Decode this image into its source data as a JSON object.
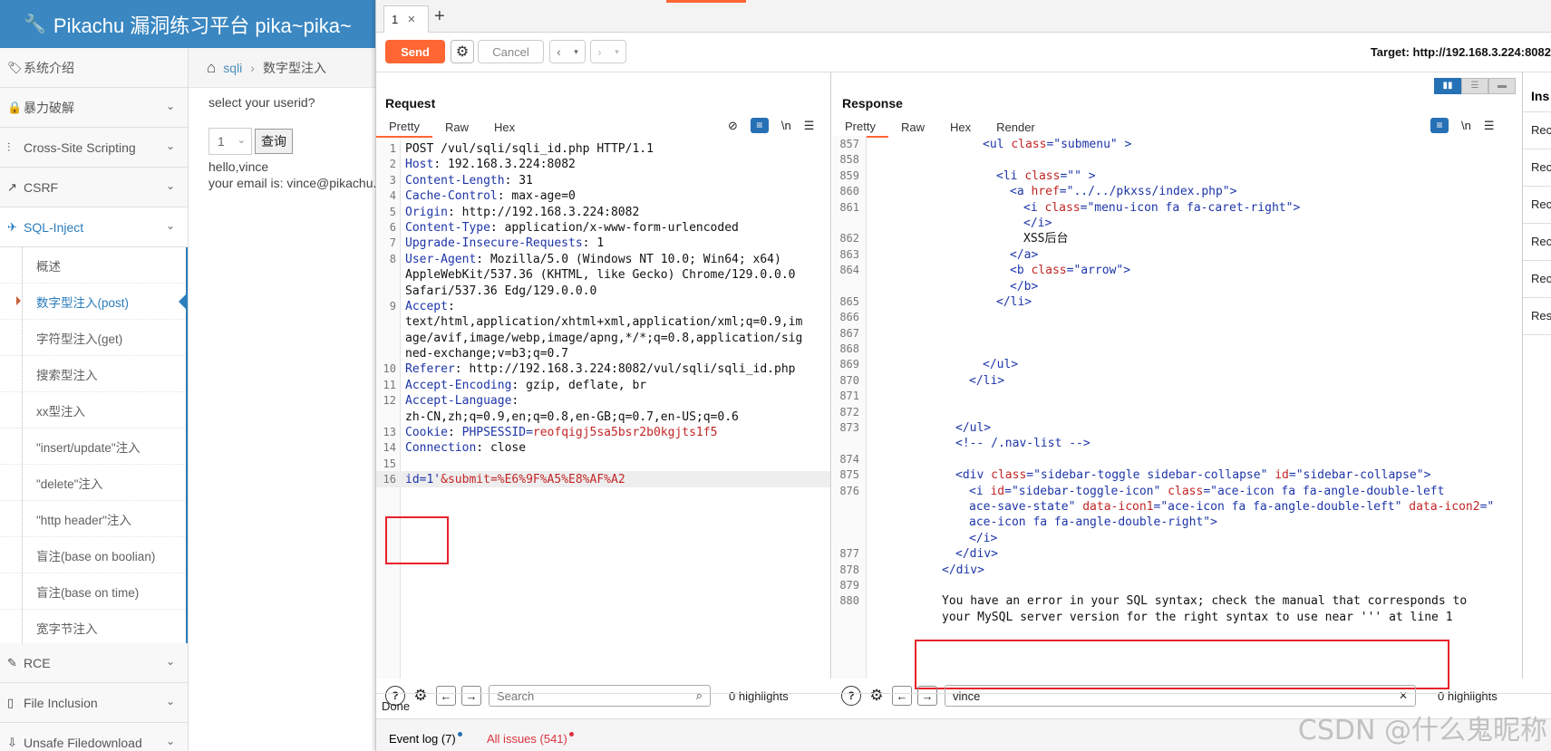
{
  "pikachu": {
    "title": "Pikachu 漏洞练习平台 pika~pika~",
    "nav": [
      {
        "label": "系统介绍",
        "icon": "tag-icon",
        "glyph": "🏷",
        "chevron": false,
        "active": false
      },
      {
        "label": "暴力破解",
        "icon": "lock-icon",
        "glyph": "🔒",
        "chevron": true,
        "active": false
      },
      {
        "label": "Cross-Site Scripting",
        "icon": "sliders-icon",
        "glyph": "⫶",
        "chevron": true,
        "active": false
      },
      {
        "label": "CSRF",
        "icon": "share-icon",
        "glyph": "↗",
        "chevron": true,
        "active": false
      },
      {
        "label": "SQL-Inject",
        "icon": "plane-icon",
        "glyph": "✈",
        "chevron": true,
        "active": true
      }
    ],
    "sql_sub": [
      "概述",
      "数字型注入(post)",
      "字符型注入(get)",
      "搜索型注入",
      "xx型注入",
      "\"insert/update\"注入",
      "\"delete\"注入",
      "\"http header\"注入",
      "盲注(base on boolian)",
      "盲注(base on time)",
      "宽字节注入"
    ],
    "nav_after": [
      {
        "label": "RCE",
        "icon": "pencil-icon",
        "glyph": "✎"
      },
      {
        "label": "File Inclusion",
        "icon": "file-icon",
        "glyph": "▯"
      },
      {
        "label": "Unsafe Filedownload",
        "icon": "download-icon",
        "glyph": "⇩"
      }
    ],
    "breadcrumb": {
      "link": "sqli",
      "current": "数字型注入"
    },
    "content": {
      "prompt": "select your userid?",
      "select_value": "1",
      "query_button": "查询",
      "line1": "hello,vince",
      "line2": "your email is: vince@pikachu.com"
    }
  },
  "burp": {
    "tab_label": "1",
    "send": "Send",
    "cancel": "Cancel",
    "target": "Target: http://192.168.3.224:8082",
    "request": {
      "title": "Request",
      "tabs": [
        "Pretty",
        "Raw",
        "Hex"
      ],
      "newline_label": "\\n",
      "search_placeholder": "Search",
      "highlights": "0 highlights"
    },
    "response": {
      "title": "Response",
      "tabs": [
        "Pretty",
        "Raw",
        "Hex",
        "Render"
      ],
      "newline_label": "\\n",
      "search_value": "vince",
      "highlights": "0 highlights"
    },
    "inspector": {
      "title": "Ins",
      "items": [
        "Rec",
        "Rec",
        "Rec",
        "Rec",
        "Rec",
        "Res"
      ]
    },
    "status": "Done",
    "event_log": "Event log (7)",
    "all_issues": "All issues (541)",
    "colors": {
      "accent": "#ff6633",
      "blue": "#2670b5",
      "red_box": "#e8212b"
    }
  },
  "request_lines": [
    {
      "n": "1",
      "t": "POST /vul/sqli/sqli_id.php HTTP/1.1"
    },
    {
      "n": "2",
      "k": "Host",
      "v": "192.168.3.224:8082"
    },
    {
      "n": "3",
      "k": "Content-Length",
      "v": "31"
    },
    {
      "n": "4",
      "k": "Cache-Control",
      "v": "max-age=0"
    },
    {
      "n": "5",
      "k": "Origin",
      "v": "http://192.168.3.224:8082"
    },
    {
      "n": "6",
      "k": "Content-Type",
      "v": "application/x-www-form-urlencoded"
    },
    {
      "n": "7",
      "k": "Upgrade-Insecure-Requests",
      "v": "1"
    },
    {
      "n": "8",
      "k": "User-Agent",
      "v": "Mozilla/5.0 (Windows NT 10.0; Win64; x64)"
    },
    {
      "n": "",
      "t": "AppleWebKit/537.36 (KHTML, like Gecko) Chrome/129.0.0.0"
    },
    {
      "n": "",
      "t": "Safari/537.36 Edg/129.0.0.0"
    },
    {
      "n": "9",
      "k": "Accept",
      "v": ""
    },
    {
      "n": "",
      "t": "text/html,application/xhtml+xml,application/xml;q=0.9,im"
    },
    {
      "n": "",
      "t": "age/avif,image/webp,image/apng,*/*;q=0.8,application/sig"
    },
    {
      "n": "",
      "t": "ned-exchange;v=b3;q=0.7"
    },
    {
      "n": "10",
      "k": "Referer",
      "v": "http://192.168.3.224:8082/vul/sqli/sqli_id.php"
    },
    {
      "n": "11",
      "k": "Accept-Encoding",
      "v": "gzip, deflate, br"
    },
    {
      "n": "12",
      "k": "Accept-Language",
      "v": ""
    },
    {
      "n": "",
      "t": "zh-CN,zh;q=0.9,en;q=0.8,en-GB;q=0.7,en-US;q=0.6"
    },
    {
      "n": "13",
      "k": "Cookie",
      "ck": "PHPSESSID",
      "cv": "reofqigj5sa5bsr2b0kgjts1f5"
    },
    {
      "n": "14",
      "k": "Connection",
      "v": "close"
    },
    {
      "n": "15",
      "t": ""
    },
    {
      "n": "16",
      "body": true,
      "p1": "id",
      "v1": "1'",
      "p2": "submit",
      "v2": "%E6%9F%A5%E8%AF%A2"
    }
  ],
  "response_lines": [
    {
      "n": "857",
      "i": 8,
      "h": [
        [
          "tag",
          "<ul "
        ],
        [
          "at",
          "class"
        ],
        [
          "tag",
          "="
        ],
        [
          "av",
          "\"submenu\""
        ],
        [
          "tag",
          " >"
        ]
      ]
    },
    {
      "n": "858",
      "i": 0,
      "h": []
    },
    {
      "n": "859",
      "i": 9,
      "h": [
        [
          "tag",
          "<li "
        ],
        [
          "at",
          "class"
        ],
        [
          "tag",
          "="
        ],
        [
          "av",
          "\"\""
        ],
        [
          "tag",
          " >"
        ]
      ]
    },
    {
      "n": "860",
      "i": 10,
      "h": [
        [
          "tag",
          "<a "
        ],
        [
          "at",
          "href"
        ],
        [
          "tag",
          "="
        ],
        [
          "av",
          "\"../../pkxss/index.php\""
        ],
        [
          "tag",
          ">"
        ]
      ]
    },
    {
      "n": "861",
      "i": 11,
      "h": [
        [
          "tag",
          "<i "
        ],
        [
          "at",
          "class"
        ],
        [
          "tag",
          "="
        ],
        [
          "av",
          "\"menu-icon fa fa-caret-right\""
        ],
        [
          "tag",
          ">"
        ]
      ]
    },
    {
      "n": "",
      "i": 11,
      "h": [
        [
          "tag",
          "</i>"
        ]
      ]
    },
    {
      "n": "862",
      "i": 11,
      "h": [
        [
          "txt",
          "XSS后台"
        ]
      ]
    },
    {
      "n": "863",
      "i": 10,
      "h": [
        [
          "tag",
          "</a>"
        ]
      ]
    },
    {
      "n": "864",
      "i": 10,
      "h": [
        [
          "tag",
          "<b "
        ],
        [
          "at",
          "class"
        ],
        [
          "tag",
          "="
        ],
        [
          "av",
          "\"arrow\""
        ],
        [
          "tag",
          ">"
        ]
      ]
    },
    {
      "n": "",
      "i": 10,
      "h": [
        [
          "tag",
          "</b>"
        ]
      ]
    },
    {
      "n": "865",
      "i": 9,
      "h": [
        [
          "tag",
          "</li>"
        ]
      ]
    },
    {
      "n": "866",
      "i": 0,
      "h": []
    },
    {
      "n": "867",
      "i": 0,
      "h": []
    },
    {
      "n": "868",
      "i": 0,
      "h": []
    },
    {
      "n": "869",
      "i": 8,
      "h": [
        [
          "tag",
          "</ul>"
        ]
      ]
    },
    {
      "n": "870",
      "i": 7,
      "h": [
        [
          "tag",
          "</li>"
        ]
      ]
    },
    {
      "n": "871",
      "i": 0,
      "h": []
    },
    {
      "n": "872",
      "i": 0,
      "h": []
    },
    {
      "n": "873",
      "i": 6,
      "h": [
        [
          "tag",
          "</ul>"
        ]
      ]
    },
    {
      "n": "",
      "i": 6,
      "h": [
        [
          "tag",
          "<!-- /.nav-list -->"
        ]
      ]
    },
    {
      "n": "874",
      "i": 0,
      "h": []
    },
    {
      "n": "875",
      "i": 6,
      "h": [
        [
          "tag",
          "<div "
        ],
        [
          "at",
          "class"
        ],
        [
          "tag",
          "="
        ],
        [
          "av",
          "\"sidebar-toggle sidebar-collapse\""
        ],
        [
          "tag",
          " "
        ],
        [
          "at",
          "id"
        ],
        [
          "tag",
          "="
        ],
        [
          "av",
          "\"sidebar-collapse\""
        ],
        [
          "tag",
          ">"
        ]
      ]
    },
    {
      "n": "876",
      "i": 7,
      "h": [
        [
          "tag",
          "<i "
        ],
        [
          "at",
          "id"
        ],
        [
          "tag",
          "="
        ],
        [
          "av",
          "\"sidebar-toggle-icon\""
        ],
        [
          "tag",
          " "
        ],
        [
          "at",
          "class"
        ],
        [
          "tag",
          "="
        ],
        [
          "av",
          "\"ace-icon fa fa-angle-double-left"
        ]
      ]
    },
    {
      "n": "",
      "i": 7,
      "h": [
        [
          "av",
          "ace-save-state\""
        ],
        [
          "tag",
          " "
        ],
        [
          "at",
          "data-icon1"
        ],
        [
          "tag",
          "="
        ],
        [
          "av",
          "\"ace-icon fa fa-angle-double-left\""
        ],
        [
          "tag",
          " "
        ],
        [
          "at",
          "data-icon2"
        ],
        [
          "tag",
          "=\""
        ]
      ]
    },
    {
      "n": "",
      "i": 7,
      "h": [
        [
          "av",
          "ace-icon fa fa-angle-double-right\""
        ],
        [
          "tag",
          ">"
        ]
      ]
    },
    {
      "n": "",
      "i": 7,
      "h": [
        [
          "tag",
          "</i>"
        ]
      ]
    },
    {
      "n": "877",
      "i": 6,
      "h": [
        [
          "tag",
          "</div>"
        ]
      ]
    },
    {
      "n": "878",
      "i": 5,
      "h": [
        [
          "tag",
          "</div>"
        ]
      ]
    },
    {
      "n": "879",
      "i": 0,
      "h": []
    },
    {
      "n": "880",
      "i": 5,
      "h": [
        [
          "txt",
          "You have an error in your SQL syntax; check the manual that corresponds to"
        ]
      ]
    },
    {
      "n": "",
      "i": 5,
      "h": [
        [
          "txt",
          "your MySQL server version for the right syntax to use near ''' at line 1"
        ]
      ]
    }
  ],
  "watermark": "CSDN @什么鬼昵称"
}
